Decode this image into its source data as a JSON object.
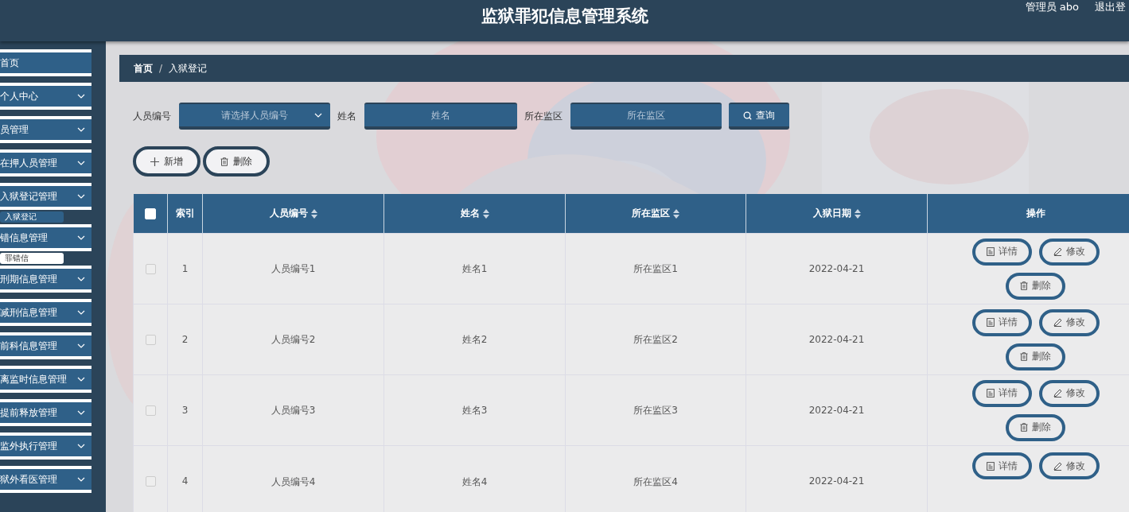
{
  "header": {
    "title": "监狱罪犯信息管理系统",
    "user": "管理员 abo",
    "logout": "退出登"
  },
  "sidebar": {
    "items": [
      {
        "label": "首页",
        "kind": "link"
      },
      {
        "label": "个人中心",
        "kind": "menu"
      },
      {
        "label": "员管理",
        "kind": "menu"
      },
      {
        "label": "在押人员管理",
        "kind": "menu"
      },
      {
        "label": "入狱登记管理",
        "kind": "menu",
        "children": [
          {
            "label": "入狱登记",
            "hovered": false
          }
        ]
      },
      {
        "label": "错信息管理",
        "kind": "menu",
        "children": [
          {
            "label": "罪错信",
            "hovered": true
          }
        ]
      },
      {
        "label": "刑期信息管理",
        "kind": "menu"
      },
      {
        "label": "减刑信息管理",
        "kind": "menu"
      },
      {
        "label": "前科信息管理",
        "kind": "menu"
      },
      {
        "label": "离监时信息管理",
        "kind": "menu"
      },
      {
        "label": "提前释放管理",
        "kind": "menu"
      },
      {
        "label": "监外执行管理",
        "kind": "menu"
      },
      {
        "label": "狱外看医管理",
        "kind": "menu"
      }
    ]
  },
  "breadcrumb": {
    "items": [
      "首页",
      "入狱登记"
    ],
    "separator": "/"
  },
  "search": {
    "fields": [
      {
        "label": "人员编号",
        "kind": "select",
        "placeholder": "请选择人员编号"
      },
      {
        "label": "姓名",
        "kind": "input",
        "placeholder": "姓名"
      },
      {
        "label": "所在监区",
        "kind": "input",
        "placeholder": "所在监区"
      }
    ],
    "button": "查询"
  },
  "actions": [
    {
      "label": "新增",
      "kind": "add"
    },
    {
      "label": "删除",
      "kind": "delete"
    }
  ],
  "table": {
    "select_all": {
      "checked": false
    },
    "columns": [
      {
        "label": "索引",
        "sortable": false
      },
      {
        "label": "人员编号",
        "sortable": true
      },
      {
        "label": "姓名",
        "sortable": true
      },
      {
        "label": "所在监区",
        "sortable": true
      },
      {
        "label": "入狱日期",
        "sortable": true
      },
      {
        "label": "操作",
        "sortable": false
      }
    ],
    "rows": [
      {
        "checked": false,
        "cells": [
          "1",
          "人员编号1",
          "姓名1",
          "所在监区1",
          "2022-04-21"
        ],
        "actions": [
          {
            "label": "详情",
            "kind": "detail"
          },
          {
            "label": "修改",
            "kind": "edit"
          },
          {
            "label": "删除",
            "kind": "delete"
          }
        ]
      },
      {
        "checked": false,
        "cells": [
          "2",
          "人员编号2",
          "姓名2",
          "所在监区2",
          "2022-04-21"
        ],
        "actions": [
          {
            "label": "详情",
            "kind": "detail"
          },
          {
            "label": "修改",
            "kind": "edit"
          },
          {
            "label": "删除",
            "kind": "delete"
          }
        ]
      },
      {
        "checked": false,
        "cells": [
          "3",
          "人员编号3",
          "姓名3",
          "所在监区3",
          "2022-04-21"
        ],
        "actions": [
          {
            "label": "详情",
            "kind": "detail"
          },
          {
            "label": "修改",
            "kind": "edit"
          },
          {
            "label": "删除",
            "kind": "delete"
          }
        ]
      },
      {
        "checked": false,
        "cells": [
          "4",
          "人员编号4",
          "姓名4",
          "所在监区4",
          "2022-04-21"
        ],
        "actions": [
          {
            "label": "详情",
            "kind": "detail"
          },
          {
            "label": "修改",
            "kind": "edit"
          }
        ]
      }
    ]
  }
}
